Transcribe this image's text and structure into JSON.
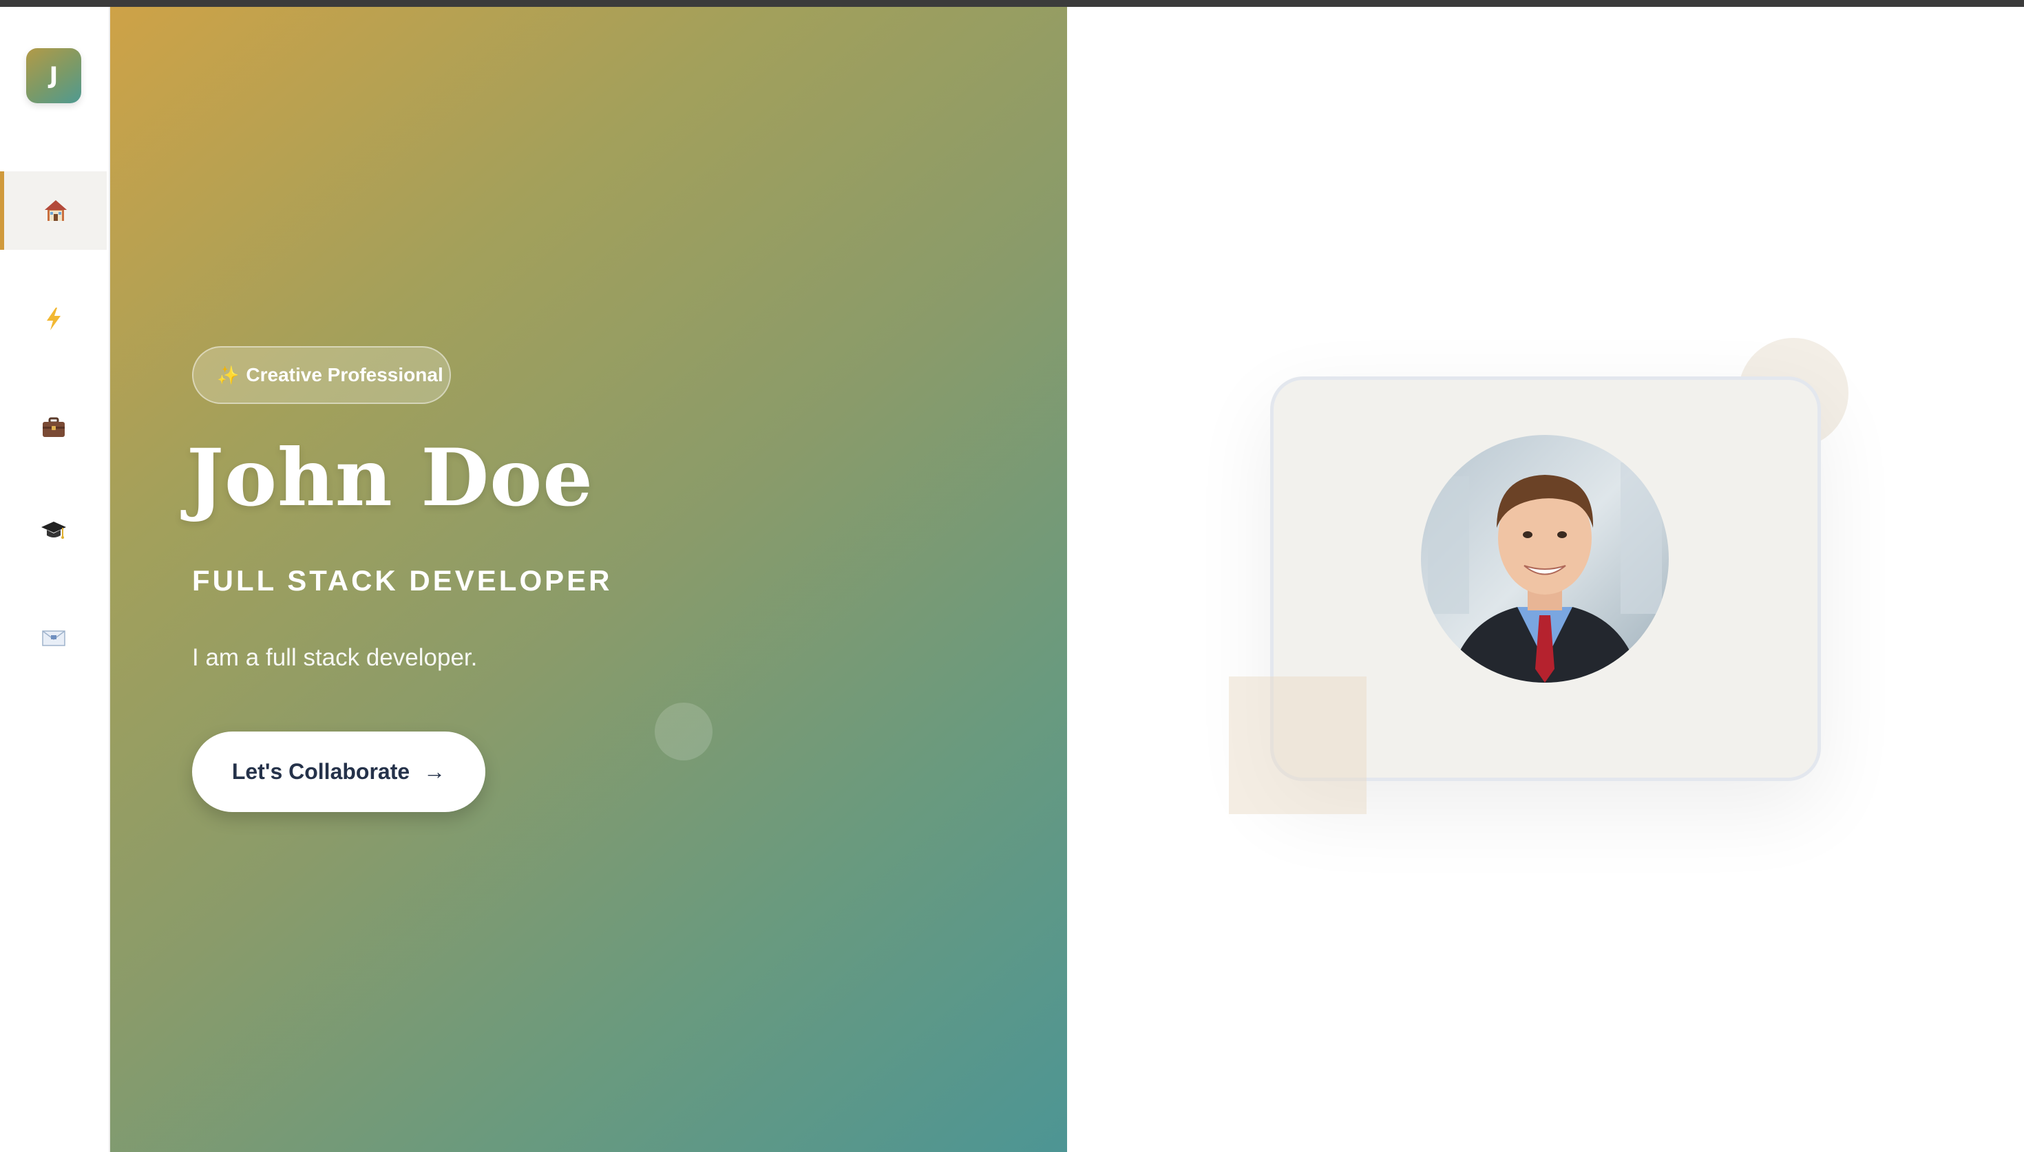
{
  "logo": {
    "letter": "J"
  },
  "nav": {
    "items": [
      {
        "icon": "home-icon",
        "active": true
      },
      {
        "icon": "lightning-icon",
        "active": false
      },
      {
        "icon": "briefcase-icon",
        "active": false
      },
      {
        "icon": "graduation-cap-icon",
        "active": false
      },
      {
        "icon": "envelope-icon",
        "active": false
      }
    ]
  },
  "hero": {
    "badge_icon": "✨",
    "badge_label": "Creative Professional",
    "name": "John Doe",
    "role": "FULL STACK DEVELOPER",
    "bio": "I am a full stack developer.",
    "cta_label": "Let's Collaborate",
    "cta_arrow": "→"
  },
  "colors": {
    "accent": "#d09a3c",
    "gradient_start": "#cea247",
    "gradient_end": "#4d9594",
    "cta_text": "#25324a"
  },
  "profile": {
    "photo": "profile-photo"
  }
}
